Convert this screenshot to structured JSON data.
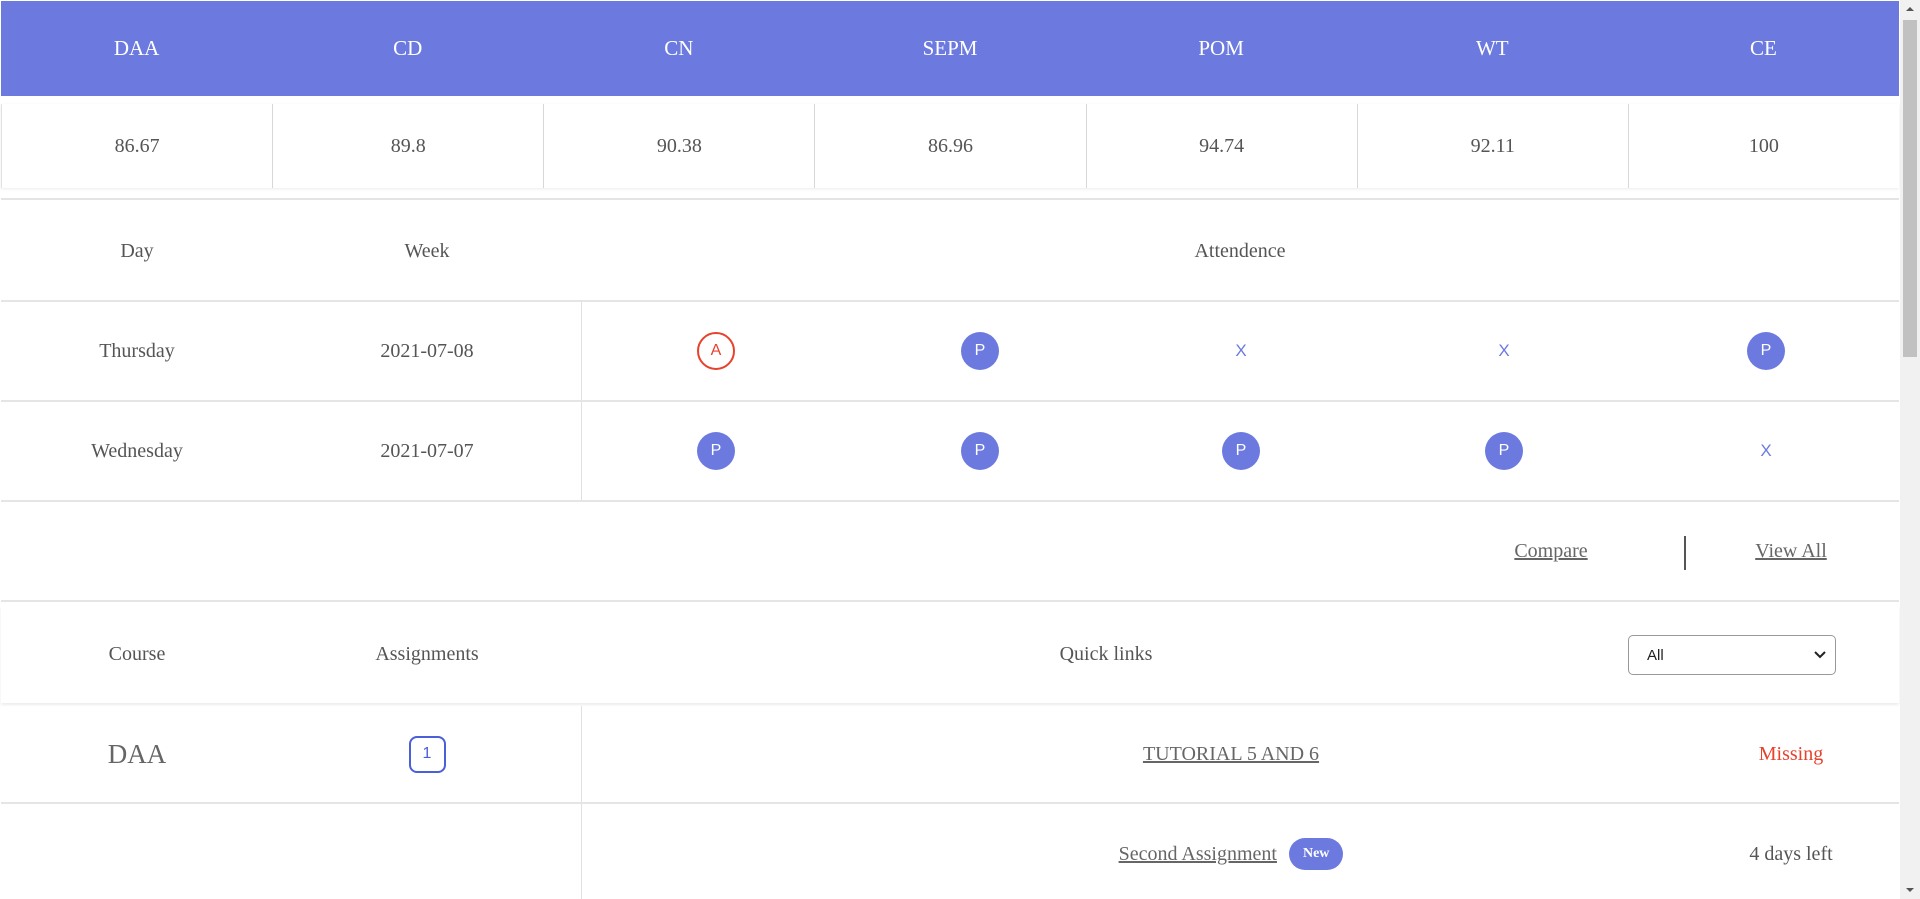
{
  "subjects": [
    "DAA",
    "CD",
    "CN",
    "SEPM",
    "POM",
    "WT",
    "CE"
  ],
  "subject_scores": [
    "86.67",
    "89.8",
    "90.38",
    "86.96",
    "94.74",
    "92.11",
    "100"
  ],
  "attendance": {
    "headers": {
      "day": "Day",
      "week": "Week",
      "attendance": "Attendence"
    },
    "rows": [
      {
        "day": "Thursday",
        "week": "2021-07-08",
        "marks": [
          "A",
          "P",
          "X",
          "X",
          "P"
        ]
      },
      {
        "day": "Wednesday",
        "week": "2021-07-07",
        "marks": [
          "P",
          "P",
          "P",
          "P",
          "X"
        ]
      }
    ],
    "compare_label": "Compare",
    "view_all_label": "View All"
  },
  "assignments": {
    "headers": {
      "course": "Course",
      "assignments": "Assignments",
      "quick_links": "Quick links"
    },
    "filter": {
      "selected": "All"
    },
    "rows": [
      {
        "course": "DAA",
        "count": "1",
        "title": "TUTORIAL 5 AND 6",
        "status": "Missing",
        "badge": ""
      },
      {
        "course": "",
        "count": "",
        "title": "Second Assignment",
        "status": "4 days left",
        "badge": "New"
      }
    ]
  },
  "colors": {
    "accent": "#6c7ae0",
    "absent": "#e8412c",
    "missing": "#e8412c"
  }
}
